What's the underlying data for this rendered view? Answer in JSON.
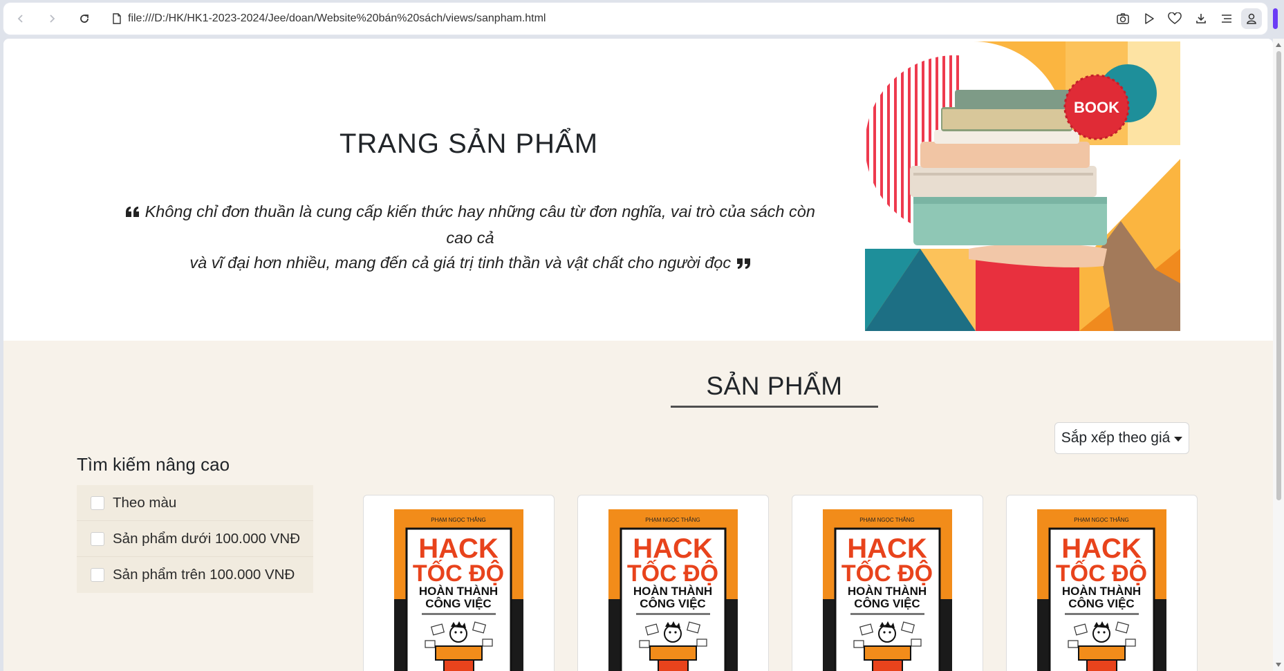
{
  "browser": {
    "url": "file:///D:/HK/HK1-2023-2024/Jee/doan/Website%20bán%20sách/views/sanpham.html"
  },
  "hero": {
    "title": "TRANG SẢN PHẨM",
    "quote_line1": "Không chỉ đơn thuần là cung cấp kiến thức hay những câu từ đơn nghĩa, vai trò của sách còn cao cả",
    "quote_line2": "và vĩ đại hơn nhiều, mang đến cả giá trị tinh thần và vật chất cho người đọc",
    "badge_text": "BOOK"
  },
  "products": {
    "section_title": "SẢN PHẨM",
    "sort_label": "Sắp xếp theo giá",
    "advanced_search_title": "Tìm kiếm nâng cao",
    "filters": [
      {
        "label": "Theo màu"
      },
      {
        "label": "Sản phẩm dưới 100.000 VNĐ"
      },
      {
        "label": "Sản phẩm trên 100.000 VNĐ"
      }
    ],
    "book_cover": {
      "author": "PHẠM NGỌC THẮNG",
      "line1": "HACK",
      "line2": "TỐC ĐỘ",
      "line3": "HOÀN THÀNH",
      "line4": "CÔNG VIỆC"
    }
  },
  "colors": {
    "section_bg": "#f7f2ea",
    "filter_bg": "#f1ebdf",
    "book_orange": "#f28c1a",
    "book_title_red": "#e8431c",
    "badge_red": "#e02b36"
  }
}
